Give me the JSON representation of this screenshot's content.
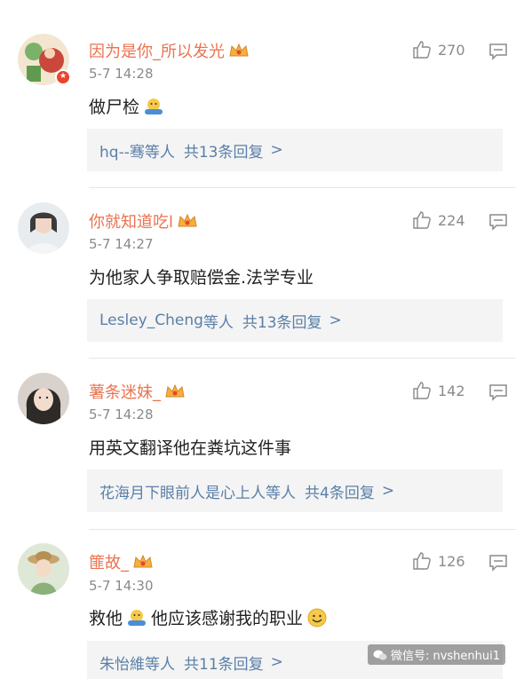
{
  "comments": [
    {
      "username": "因为是你_所以发光",
      "time": "5-7 14:28",
      "text_before": "做尸检",
      "text_after": "",
      "likes": "270",
      "reply_user": "hq--骞",
      "reply_suffix": "等人",
      "reply_count": "共13条回复",
      "reply_arrow": ">"
    },
    {
      "username": "你就知道吃l",
      "time": "5-7 14:27",
      "text_before": "为他家人争取赔偿金.法学专业",
      "text_after": "",
      "likes": "224",
      "reply_user": "Lesley_Cheng",
      "reply_suffix": "等人",
      "reply_count": "共13条回复",
      "reply_arrow": ">"
    },
    {
      "username": "薯条迷妹_",
      "time": "5-7 14:28",
      "text_before": "用英文翻译他在粪坑这件事",
      "text_after": "",
      "likes": "142",
      "reply_user": "花海月下眼前人是心上人",
      "reply_suffix": "等人",
      "reply_count": "共4条回复",
      "reply_arrow": ">"
    },
    {
      "username": "篚故_",
      "time": "5-7 14:30",
      "text_before": "救他",
      "text_after": "他应该感谢我的职业",
      "likes": "126",
      "reply_user": "朱怡維",
      "reply_suffix": "等人",
      "reply_count": "共11条回复",
      "reply_arrow": ">"
    }
  ],
  "watermark": {
    "label": "微信号: nvshenhui1"
  },
  "colors": {
    "username": "#eb7350",
    "link": "#5a7fa8",
    "meta": "#8a8a8a",
    "reply_bg": "#f4f4f4"
  }
}
